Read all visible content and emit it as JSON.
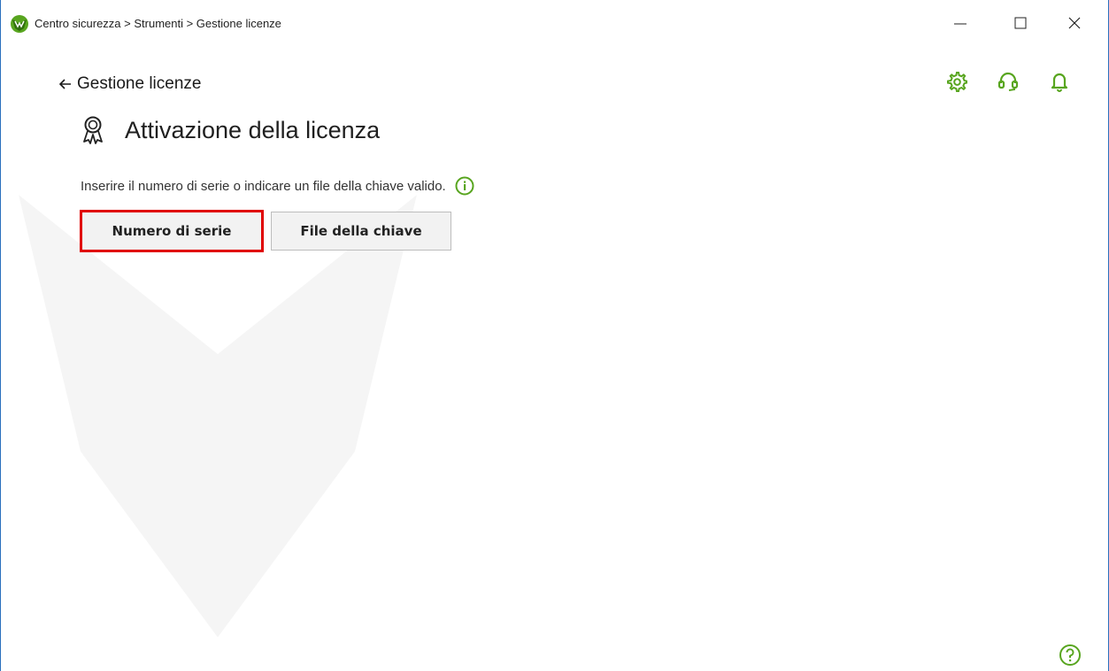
{
  "window": {
    "title": "Centro sicurezza > Strumenti > Gestione licenze",
    "controls": [
      "minimize",
      "maximize",
      "close"
    ]
  },
  "header": {
    "back_label": "Gestione licenze",
    "icons": [
      "settings-icon",
      "support-icon",
      "notifications-icon"
    ]
  },
  "page": {
    "title": "Attivazione della licenza",
    "description": "Inserire il numero di serie o indicare un file della chiave valido."
  },
  "buttons": {
    "serial_number": "Numero di serie",
    "key_file": "File della chiave"
  },
  "colors": {
    "accent": "#58a51f",
    "highlight": "#e00000",
    "button_bg": "#f2f2f2",
    "button_border": "#bdbdbd"
  }
}
